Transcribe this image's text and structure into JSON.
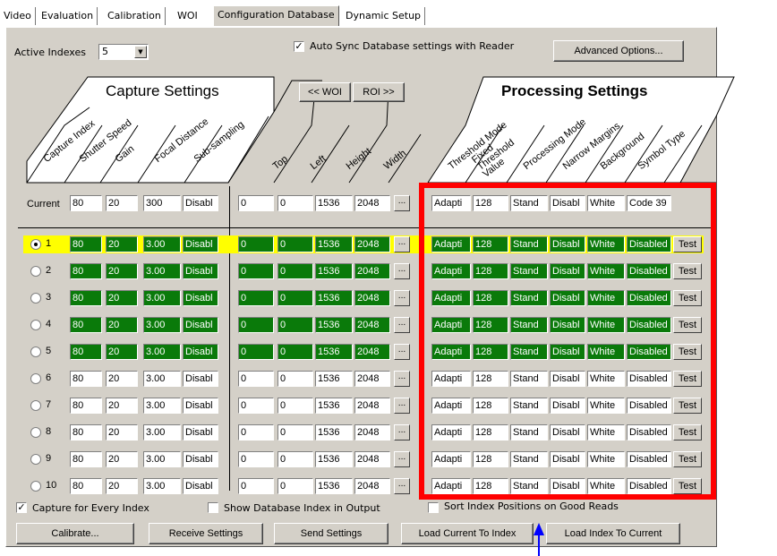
{
  "tabs": [
    {
      "label": "Video"
    },
    {
      "label": "Evaluation"
    },
    {
      "label": "Calibration"
    },
    {
      "label": "WOI"
    },
    {
      "label": "Configuration Database"
    },
    {
      "label": "Dynamic Setup"
    }
  ],
  "top": {
    "active_indexes_label": "Active Indexes",
    "active_indexes_value": "5",
    "auto_sync_label": "Auto Sync Database settings with Reader",
    "auto_sync_checked": true,
    "advanced_button": "Advanced Options..."
  },
  "sections": {
    "capture_title": "Capture Settings",
    "processing_title": "Processing Settings",
    "woi_button": "<< WOI",
    "roi_button": "ROI >>"
  },
  "capture_headers": [
    "Capture Index",
    "Shutter Speed",
    "Gain",
    "Focal Distance",
    "Sub-sampling"
  ],
  "roi_headers": [
    "Top",
    "Left",
    "Height",
    "Width"
  ],
  "processing_headers": [
    "Threshold Mode",
    "Fixed Threshold Value",
    "Processing Mode",
    "Narrow Margins",
    "Background",
    "Symbol Type"
  ],
  "current": {
    "label": "Current",
    "capture": [
      "80",
      "20",
      "300",
      "Disabl"
    ],
    "roi": [
      "0",
      "0",
      "1536",
      "2048"
    ],
    "processing": [
      "Adapti",
      "128",
      "Stand",
      "Disabl",
      "White",
      "Code 39"
    ]
  },
  "rows": [
    {
      "index": "1",
      "selected": true,
      "active": true,
      "capture": [
        "80",
        "20",
        "3.00",
        "Disabl"
      ],
      "roi": [
        "0",
        "0",
        "1536",
        "2048"
      ],
      "processing": [
        "Adapti",
        "128",
        "Stand",
        "Disabl",
        "White",
        "Disabled"
      ]
    },
    {
      "index": "2",
      "selected": false,
      "active": true,
      "capture": [
        "80",
        "20",
        "3.00",
        "Disabl"
      ],
      "roi": [
        "0",
        "0",
        "1536",
        "2048"
      ],
      "processing": [
        "Adapti",
        "128",
        "Stand",
        "Disabl",
        "White",
        "Disabled"
      ]
    },
    {
      "index": "3",
      "selected": false,
      "active": true,
      "capture": [
        "80",
        "20",
        "3.00",
        "Disabl"
      ],
      "roi": [
        "0",
        "0",
        "1536",
        "2048"
      ],
      "processing": [
        "Adapti",
        "128",
        "Stand",
        "Disabl",
        "White",
        "Disabled"
      ]
    },
    {
      "index": "4",
      "selected": false,
      "active": true,
      "capture": [
        "80",
        "20",
        "3.00",
        "Disabl"
      ],
      "roi": [
        "0",
        "0",
        "1536",
        "2048"
      ],
      "processing": [
        "Adapti",
        "128",
        "Stand",
        "Disabl",
        "White",
        "Disabled"
      ]
    },
    {
      "index": "5",
      "selected": false,
      "active": true,
      "capture": [
        "80",
        "20",
        "3.00",
        "Disabl"
      ],
      "roi": [
        "0",
        "0",
        "1536",
        "2048"
      ],
      "processing": [
        "Adapti",
        "128",
        "Stand",
        "Disabl",
        "White",
        "Disabled"
      ]
    },
    {
      "index": "6",
      "selected": false,
      "active": false,
      "capture": [
        "80",
        "20",
        "3.00",
        "Disabl"
      ],
      "roi": [
        "0",
        "0",
        "1536",
        "2048"
      ],
      "processing": [
        "Adapti",
        "128",
        "Stand",
        "Disabl",
        "White",
        "Disabled"
      ]
    },
    {
      "index": "7",
      "selected": false,
      "active": false,
      "capture": [
        "80",
        "20",
        "3.00",
        "Disabl"
      ],
      "roi": [
        "0",
        "0",
        "1536",
        "2048"
      ],
      "processing": [
        "Adapti",
        "128",
        "Stand",
        "Disabl",
        "White",
        "Disabled"
      ]
    },
    {
      "index": "8",
      "selected": false,
      "active": false,
      "capture": [
        "80",
        "20",
        "3.00",
        "Disabl"
      ],
      "roi": [
        "0",
        "0",
        "1536",
        "2048"
      ],
      "processing": [
        "Adapti",
        "128",
        "Stand",
        "Disabl",
        "White",
        "Disabled"
      ]
    },
    {
      "index": "9",
      "selected": false,
      "active": false,
      "capture": [
        "80",
        "20",
        "3.00",
        "Disabl"
      ],
      "roi": [
        "0",
        "0",
        "1536",
        "2048"
      ],
      "processing": [
        "Adapti",
        "128",
        "Stand",
        "Disabl",
        "White",
        "Disabled"
      ]
    },
    {
      "index": "10",
      "selected": false,
      "active": false,
      "capture": [
        "80",
        "20",
        "3.00",
        "Disabl"
      ],
      "roi": [
        "0",
        "0",
        "1536",
        "2048"
      ],
      "processing": [
        "Adapti",
        "128",
        "Stand",
        "Disabl",
        "White",
        "Disabled"
      ]
    }
  ],
  "ellipsis_label": "...",
  "test_label": "Test",
  "bottom": {
    "capture_every_label": "Capture for Every Index",
    "capture_every_checked": true,
    "show_db_index_label": "Show Database Index in Output",
    "show_db_index_checked": false,
    "sort_label": "Sort Index Positions on Good Reads",
    "sort_checked": false,
    "buttons": [
      "Calibrate...",
      "Receive Settings",
      "Send Settings",
      "Load Current To Index",
      "Load Index To Current"
    ]
  },
  "colors": {
    "active_cell": "#0a7a0a",
    "highlight": "#ffff00",
    "annotation": "#ff0000",
    "arrow": "#0000ff"
  }
}
